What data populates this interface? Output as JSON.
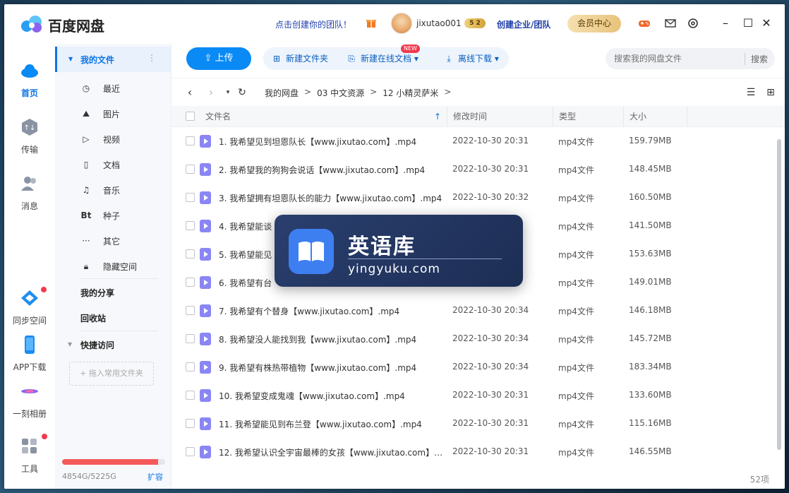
{
  "app": {
    "title": "百度网盘",
    "team_link": "点击创建你的团队！",
    "username": "jixutao001",
    "vip_badge": "5 2",
    "enterprise_link": "创建企业/团队",
    "member_center": "会员中心"
  },
  "rail": {
    "home": "首页",
    "transfer": "传输",
    "messages": "消息",
    "sync": "同步空间",
    "app_download": "APP下载",
    "album": "一刻相册",
    "tools": "工具"
  },
  "sidebar": {
    "my_files": "我的文件",
    "recent": "最近",
    "images": "图片",
    "videos": "视频",
    "docs": "文档",
    "music": "音乐",
    "seeds_icon": "Bt",
    "seeds": "种子",
    "other": "其它",
    "hidden": "隐藏空间",
    "my_share": "我的分享",
    "recycle": "回收站",
    "quick_access": "快捷访问",
    "drop_hint": "+ 拖入常用文件夹",
    "quota_text": "4854G/5225G",
    "quota_fraction": 0.929,
    "expand": "扩容"
  },
  "toolbar": {
    "upload": "上传",
    "new_folder": "新建文件夹",
    "new_doc": "新建在线文档",
    "new_badge": "NEW",
    "offline_download": "离线下载",
    "search_placeholder": "搜索我的网盘文件",
    "search_button": "搜索"
  },
  "path": {
    "crumbs": [
      "我的网盘",
      "03 中文资源",
      "12 小精灵萨米"
    ],
    "sep": ">"
  },
  "table": {
    "headers": {
      "name": "文件名",
      "time": "修改时间",
      "type": "类型",
      "size": "大小"
    },
    "rows": [
      {
        "name": "1. 我希望见到坦恩队长【www.jixutao.com】.mp4",
        "time": "2022-10-30 20:31",
        "type": "mp4文件",
        "size": "159.79MB"
      },
      {
        "name": "2. 我希望我的狗狗会说话【www.jixutao.com】.mp4",
        "time": "2022-10-30 20:31",
        "type": "mp4文件",
        "size": "148.45MB"
      },
      {
        "name": "3. 我希望拥有坦恩队长的能力【www.jixutao.com】.mp4",
        "time": "2022-10-30 20:32",
        "type": "mp4文件",
        "size": "160.50MB"
      },
      {
        "name": "4. 我希望能谈",
        "time": "",
        "type": "mp4文件",
        "size": "141.50MB"
      },
      {
        "name": "5. 我希望能见",
        "time": "",
        "type": "mp4文件",
        "size": "153.63MB"
      },
      {
        "name": "6. 我希望有台",
        "time": "",
        "type": "mp4文件",
        "size": "149.01MB"
      },
      {
        "name": "7. 我希望有个替身【www.jixutao.com】.mp4",
        "time": "2022-10-30 20:34",
        "type": "mp4文件",
        "size": "146.18MB"
      },
      {
        "name": "8. 我希望没人能找到我【www.jixutao.com】.mp4",
        "time": "2022-10-30 20:34",
        "type": "mp4文件",
        "size": "145.72MB"
      },
      {
        "name": "9. 我希望有株热带植物【www.jixutao.com】.mp4",
        "time": "2022-10-30 20:34",
        "type": "mp4文件",
        "size": "183.34MB"
      },
      {
        "name": "10. 我希望变成鬼魂【www.jixutao.com】.mp4",
        "time": "2022-10-30 20:31",
        "type": "mp4文件",
        "size": "133.60MB"
      },
      {
        "name": "11. 我希望能见到布兰登【www.jixutao.com】.mp4",
        "time": "2022-10-30 20:31",
        "type": "mp4文件",
        "size": "115.16MB"
      },
      {
        "name": "12. 我希望认识全宇宙最棒的女孩【www.jixutao.com】....",
        "time": "2022-10-30 20:31",
        "type": "mp4文件",
        "size": "146.55MB"
      }
    ],
    "count": "52项"
  },
  "watermark": {
    "title": "英语库",
    "url": "yingyuku.com"
  },
  "colors": {
    "accent": "#0a74e6",
    "upload": "#0a8af5",
    "video_icon": "#8a86f5",
    "quota": "#f55a5a"
  }
}
